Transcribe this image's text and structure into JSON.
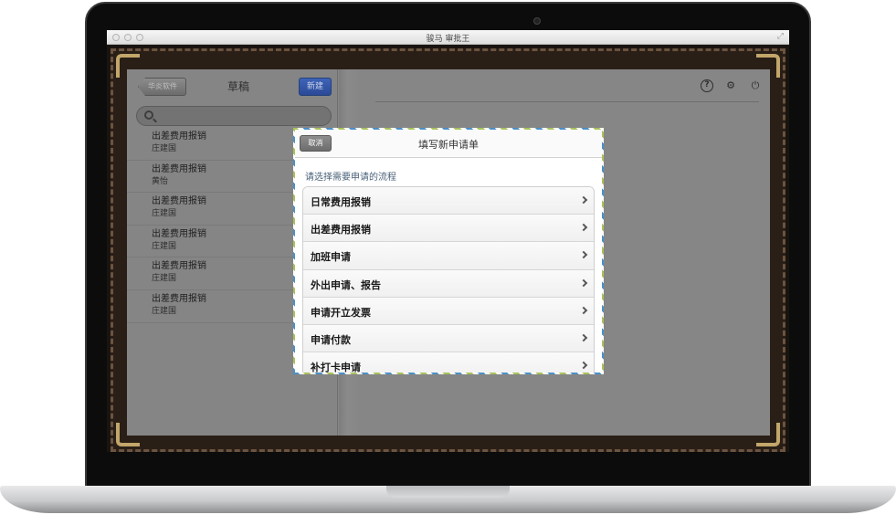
{
  "window": {
    "title": "骏马 审批王"
  },
  "left_pane": {
    "back_label": "华炎软件",
    "title": "草稿",
    "new_label": "新建",
    "search_placeholder": "",
    "items": [
      {
        "title": "出差费用报销",
        "person": "庄建国"
      },
      {
        "title": "出差费用报销",
        "person": "黄怡"
      },
      {
        "title": "出差费用报销",
        "person": "庄建国"
      },
      {
        "title": "出差费用报销",
        "person": "庄建国"
      },
      {
        "title": "出差费用报销",
        "person": "庄建国"
      },
      {
        "title": "出差费用报销",
        "person": "庄建国"
      }
    ]
  },
  "right_pane": {
    "icons": [
      "help-icon",
      "user-settings-icon",
      "power-icon"
    ],
    "help_glyph": "?",
    "user_glyph": "⚙",
    "power_glyph": "⏻"
  },
  "modal": {
    "cancel_label": "取消",
    "title": "填写新申请单",
    "prompt": "请选择需要申请的流程",
    "processes": [
      "日常费用报销",
      "出差费用报销",
      "加班申请",
      "外出申请、报告",
      "申请开立发票",
      "申请付款",
      "补打卡申请"
    ]
  },
  "colors": {
    "accent_blue": "#2a4a97",
    "dim_overlay": "#878787",
    "frame_gold": "#c2a66a",
    "prompt_text": "#4a6179"
  }
}
